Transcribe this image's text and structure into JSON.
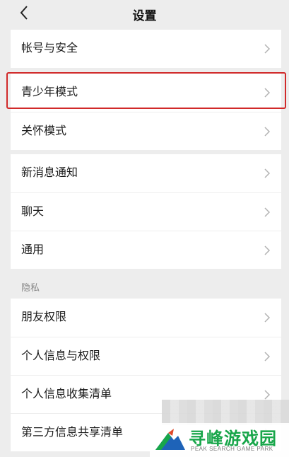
{
  "header": {
    "title": "设置",
    "back_icon": "chevron-left-icon"
  },
  "groups": {
    "account": [
      "帐号与安全"
    ],
    "modes": [
      "青少年模式",
      "关怀模式"
    ],
    "general": [
      "新消息通知",
      "聊天",
      "通用"
    ],
    "privacy_label": "隐私",
    "privacy": [
      "朋友权限",
      "个人信息与权限",
      "个人信息收集清单",
      "第三方信息共享清单"
    ]
  },
  "highlight_color": "#d12a2a",
  "watermark": {
    "title": "寻峰游戏园",
    "subtitle": "PEAK SEARCH GAME PARK",
    "color": "#18a64a"
  }
}
